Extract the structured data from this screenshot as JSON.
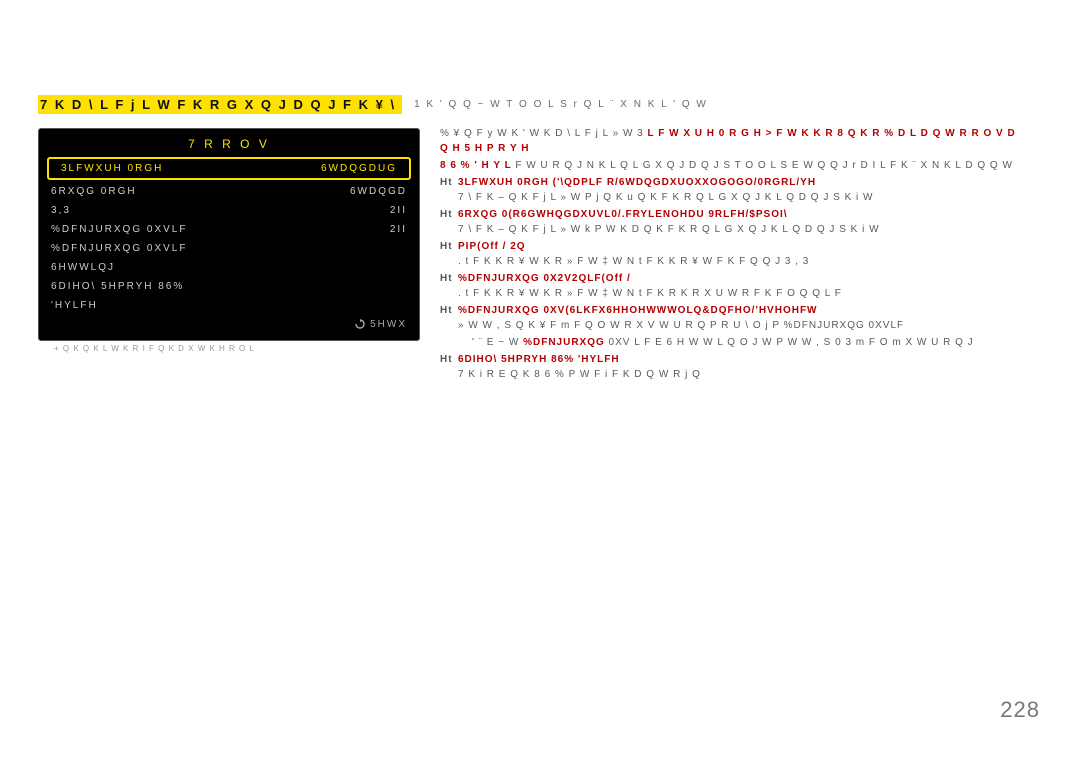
{
  "page_number": "228",
  "title_main": "7 K D \\  L   F j L W   F K R   G X Q J   D Q J   F K ¥ \\",
  "title_tail": "1 K ' Q  Q ~ W  T O O L S r  Q  L ¨ X  N K L ' Q  W",
  "panel": {
    "title": "7 R R O V",
    "rows": [
      {
        "label": "3LFWXUH 0RGH",
        "value": "6WDQGDUG",
        "selected": true
      },
      {
        "label": "6RXQG 0RGH",
        "value": "6WDQGD"
      },
      {
        "label": "3,3",
        "value": "2II"
      },
      {
        "label": "%DFNJURXQG 0XVLF",
        "value": "2II"
      },
      {
        "label": "%DFNJURXQG 0XVLF",
        "value": ""
      },
      {
        "label": "6HWWLQJ",
        "value": ""
      },
      {
        "label": "6DIHO\\ 5HPRYH 86%",
        "value": ""
      },
      {
        "label": "'HYLFH",
        "value": ""
      }
    ],
    "return": "5HWX"
  },
  "footnote": "+ Q K  Q K L   W K R I F   Q K D X W K H R  O   L",
  "right_lines": [
    {
      "text": "% ¥  Q  F y  W K '  W K D \\  L  F j L  » W  3 L F W X U H 0 R G H > F W K K R 8 Q K R % D L D Q W R R O V D Q H 5 H P R Y H",
      "red_from": 45
    },
    {
      "text": "8 6 %  ' H Y L F W U R Q J  N K L  Q  L  G X Q J  D Q J  S T O O L S  E  W Q Q J r D I L F K ¨ X N K L D Q Q  W",
      "red_to": 15
    },
    {
      "type": "bullet",
      "head": "3LFWXUH 0RGH ('\\QDPLF R/6WDQGDXUOXXOGOGO/0RGRL/YH",
      "body": "7 \\  F K – Q K  F j L  » W  P j Q  K u Q K  F K R  Q  L  G X Q J  K L  Q  D Q J  S K i W"
    },
    {
      "type": "bullet",
      "head": "6RXQG 0(R6GWHQGDXUVL0/.FRYLENOHDU 9RLFH/$PSOI\\",
      "body": "7 \\  F K – Q K  F j L  » W  k P  W K D Q K  F K R  Q  L  G X Q J  K L  Q  D Q J  S K i W"
    },
    {
      "type": "bullet",
      "head": "PIP(Off / 2Q",
      "body": ". t F K  K R ¥ W  K R » F  W ‡ W  N t F K  K R ¥ W  F K  F  Q Q J  3 , 3"
    },
    {
      "type": "bullet",
      "head": "%DFNJURXQG 0X2V2QLF(Off /",
      "body": ". t F K  K R ¥ W  K R » F  W ‡ W  N t F K R K R X U W R F K F O Q Q L F"
    },
    {
      "type": "bullet",
      "head": "%DFNJURXQG 0XV(6LKFX6HHOHWWWOLQ&DQFHO/'HVHOHFW",
      "body": "» W  W  ,  S  Q K ¥ F  m  F Q O W R X V W U R Q P R U \\  O j P  %DFNJURXQG 0XVLF"
    },
    {
      "type": "indent",
      "body": "' ¨  E ~ W  %DFNJURXQG  0XV L F E 6 H W W L Q O J W  P  W  W  ,  S  0 3  m  F  O m X  W U R Q J"
    },
    {
      "type": "bullet",
      "head": "6DIHO\\ 5HPRYH 86% 'HYLFH",
      "body": "7 K i R  E  Q K  8 6 %  P  W  F i F K  D Q  W R j Q"
    }
  ]
}
